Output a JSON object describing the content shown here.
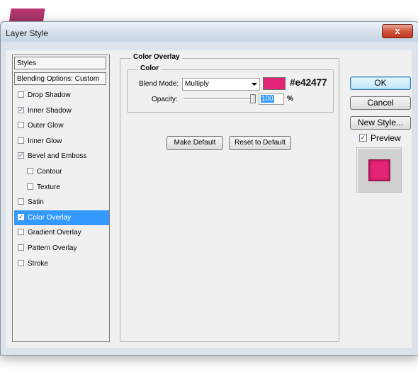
{
  "window": {
    "title": "Layer Style",
    "close_label": "x"
  },
  "styles_panel": {
    "header": "Styles",
    "blending_options": "Blending Options: Custom",
    "items": [
      {
        "label": "Drop Shadow",
        "checked": false,
        "indent": false
      },
      {
        "label": "Inner Shadow",
        "checked": true,
        "indent": false
      },
      {
        "label": "Outer Glow",
        "checked": false,
        "indent": false
      },
      {
        "label": "Inner Glow",
        "checked": false,
        "indent": false
      },
      {
        "label": "Bevel and Emboss",
        "checked": true,
        "indent": false
      },
      {
        "label": "Contour",
        "checked": false,
        "indent": true
      },
      {
        "label": "Texture",
        "checked": false,
        "indent": true
      },
      {
        "label": "Satin",
        "checked": false,
        "indent": false
      },
      {
        "label": "Color Overlay",
        "checked": true,
        "indent": false,
        "selected": true
      },
      {
        "label": "Gradient Overlay",
        "checked": false,
        "indent": false
      },
      {
        "label": "Pattern Overlay",
        "checked": false,
        "indent": false
      },
      {
        "label": "Stroke",
        "checked": false,
        "indent": false
      }
    ]
  },
  "color_overlay": {
    "group_title": "Color Overlay",
    "sub_title": "Color",
    "blend_mode_label": "Blend Mode:",
    "blend_mode_value": "Multiply",
    "color_hex": "#e42477",
    "color_annotation": "#e42477",
    "opacity_label": "Opacity:",
    "opacity_value": "100",
    "opacity_unit": "%",
    "make_default": "Make Default",
    "reset_default": "Reset to Default"
  },
  "actions": {
    "ok": "OK",
    "cancel": "Cancel",
    "new_style": "New Style...",
    "preview_label": "Preview",
    "preview_checked": true
  },
  "colors": {
    "overlay": "#e42477",
    "selection": "#3399ff"
  }
}
